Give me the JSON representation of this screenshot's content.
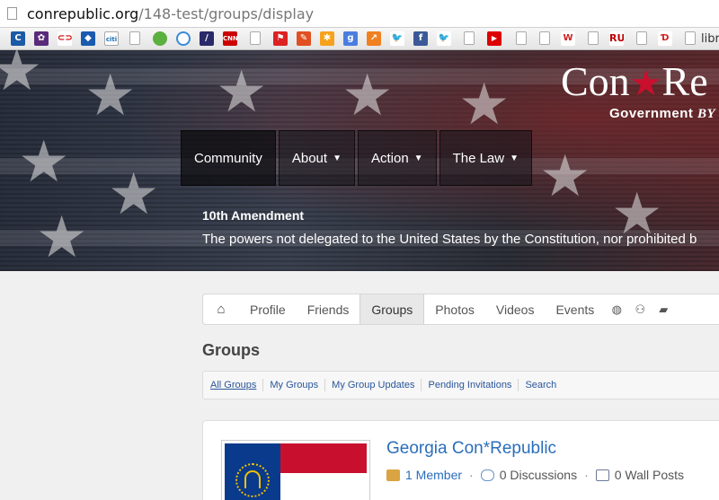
{
  "browser": {
    "url_host": "conrepublic.org",
    "url_path": "/148-test/groups/display",
    "bookmark_overflow_label": "libra"
  },
  "hero": {
    "brand_left": "Con",
    "brand_right": "Re",
    "tagline_left": "Government ",
    "tagline_italic": "BY"
  },
  "mainnav": {
    "items": [
      {
        "label": "Community",
        "has_caret": false
      },
      {
        "label": "About",
        "has_caret": true
      },
      {
        "label": "Action",
        "has_caret": true
      },
      {
        "label": "The Law",
        "has_caret": true
      }
    ]
  },
  "amendment": {
    "title": "10th Amendment",
    "text": "The powers not delegated to the United States by the Constitution, nor prohibited b"
  },
  "subnav": {
    "home_icon": "home-icon",
    "tabs": [
      "Profile",
      "Friends",
      "Groups",
      "Photos",
      "Videos",
      "Events"
    ],
    "active_tab": "Groups",
    "icons": [
      "globe-icon",
      "people-icon",
      "chat-icon"
    ]
  },
  "page": {
    "heading": "Groups"
  },
  "filters": [
    "All Groups",
    "My Groups",
    "My Group Updates",
    "Pending Invitations",
    "Search"
  ],
  "group": {
    "title": "Georgia Con*Republic",
    "members": "1 Member",
    "discussions": "0 Discussions",
    "wall_posts": "0 Wall Posts"
  },
  "colors": {
    "link": "#2a6ebb",
    "brand_star": "#c8102e"
  }
}
